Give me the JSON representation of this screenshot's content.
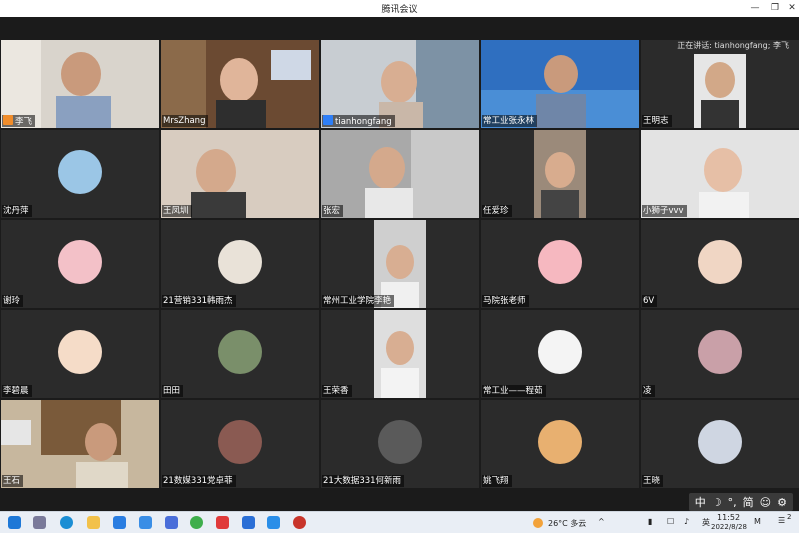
{
  "window": {
    "title": "腾讯会议",
    "min": "—",
    "max": "❐",
    "close": "✕"
  },
  "speaking": "正在讲话: tianhongfang; 李飞",
  "participants": [
    {
      "name": "李飞",
      "badge": "host"
    },
    {
      "name": "MrsZhang"
    },
    {
      "name": "tianhongfang",
      "badge": "cohost"
    },
    {
      "name": "常工业张永林"
    },
    {
      "name": "王明志"
    },
    {
      "name": "沈丹萍"
    },
    {
      "name": "王凤圳"
    },
    {
      "name": "张宏"
    },
    {
      "name": "任爱珍"
    },
    {
      "name": "小狮子vvv"
    },
    {
      "name": "谢玲"
    },
    {
      "name": "21营销331韩雨杰"
    },
    {
      "name": "常州工业学院李艳"
    },
    {
      "name": "马院张老师"
    },
    {
      "name": "6V"
    },
    {
      "name": "李碧晨"
    },
    {
      "name": "田田"
    },
    {
      "name": "王荣香"
    },
    {
      "name": "常工业——程茹"
    },
    {
      "name": "凌"
    },
    {
      "name": "王石"
    },
    {
      "name": "21数媒331党卓菲"
    },
    {
      "name": "21大数据331何新雨"
    },
    {
      "name": "姚飞翔"
    },
    {
      "name": "王晓"
    }
  ],
  "ime": {
    "mode": "中",
    "moon": "☽",
    "punct": "°,",
    "simp": "简",
    "emoji": "☺",
    "gear": "⚙"
  },
  "taskbar": {
    "weather": "26°C 多云",
    "time": "11:52",
    "date": "2022/8/28",
    "notify": "2"
  },
  "colors": {
    "tile": "#2b2b2b",
    "background": "#1b1b1b",
    "host_badge": "#f08c2a",
    "cohost_badge": "#2d7ef7"
  }
}
